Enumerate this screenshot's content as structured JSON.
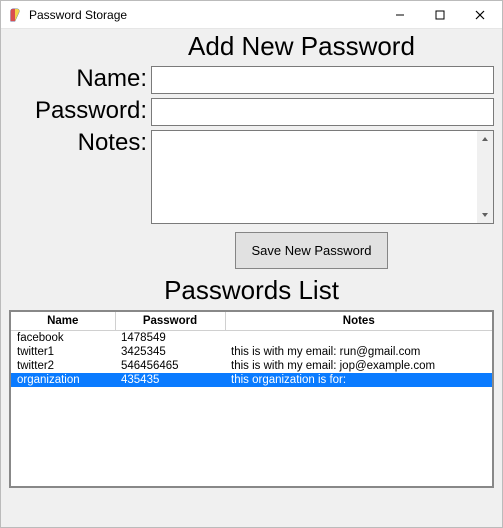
{
  "window": {
    "title": "Password Storage"
  },
  "headings": {
    "add": "Add New Password",
    "list": "Passwords List"
  },
  "form": {
    "name_label": "Name:",
    "password_label": "Password:",
    "notes_label": "Notes:",
    "name_value": "",
    "password_value": "",
    "notes_value": "",
    "save_label": "Save New Password"
  },
  "table": {
    "columns": {
      "name": "Name",
      "password": "Password",
      "notes": "Notes"
    },
    "rows": [
      {
        "name": "facebook",
        "password": "1478549",
        "notes": "",
        "selected": false
      },
      {
        "name": "twitter1",
        "password": "3425345",
        "notes": "this is with my email: run@gmail.com",
        "selected": false
      },
      {
        "name": "twitter2",
        "password": "546456465",
        "notes": "this is with my email: jop@example.com",
        "selected": false
      },
      {
        "name": "organization",
        "password": "435435",
        "notes": "this organization is for:",
        "selected": true
      }
    ]
  }
}
